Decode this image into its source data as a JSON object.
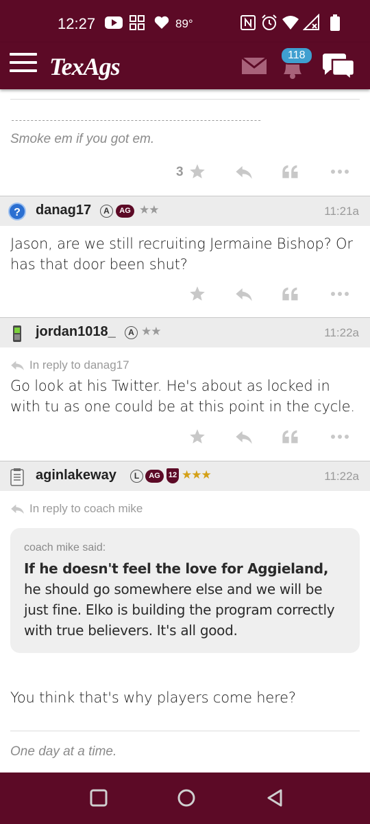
{
  "status_bar": {
    "time": "12:27",
    "temperature": "89°"
  },
  "header": {
    "logo": "TexAgs",
    "notification_count": "118"
  },
  "posts": [
    {
      "signature": "Smoke em if you got em.",
      "star_count": "3"
    },
    {
      "username": "danag17",
      "badges": [
        "A",
        "AG"
      ],
      "stars": "★★",
      "time": "11:21a",
      "body": "Jason, are we still recruiting Jermaine Bishop? Or has that door been shut?"
    },
    {
      "username": "jordan1018_",
      "badges": [
        "A"
      ],
      "stars": "★★",
      "time": "11:22a",
      "reply_to": "In reply to danag17",
      "body": "Go look at his Twitter. He's about as locked in with tu as one could be at this point in the cycle."
    },
    {
      "username": "aginlakeway",
      "badges": [
        "L",
        "AG",
        "12"
      ],
      "stars": "★★★",
      "time": "11:22a",
      "reply_to": "In reply to coach mike",
      "quote_by": "coach mike said:",
      "quote_bold": "If he doesn't feel the love for Aggieland,",
      "quote_rest": " he should go somewhere else and we will be just fine. Elko is building the program correctly with true believers. It's all good.",
      "body": "You think that's why players come here?",
      "signature": "One day at a time."
    }
  ],
  "colors": {
    "brand": "#5c0a26",
    "badge_blue": "#3f9fd0",
    "gold": "#d4a017"
  },
  "icons": [
    "youtube-icon",
    "grid-icon",
    "heart-icon",
    "nfc-icon",
    "alarm-icon",
    "wifi-icon",
    "signal-icon",
    "battery-icon",
    "menu-icon",
    "mail-icon",
    "bell-icon",
    "chat-icon",
    "star-icon",
    "reply-icon",
    "quote-icon",
    "more-icon",
    "square-nav-icon",
    "circle-nav-icon",
    "back-nav-icon"
  ]
}
